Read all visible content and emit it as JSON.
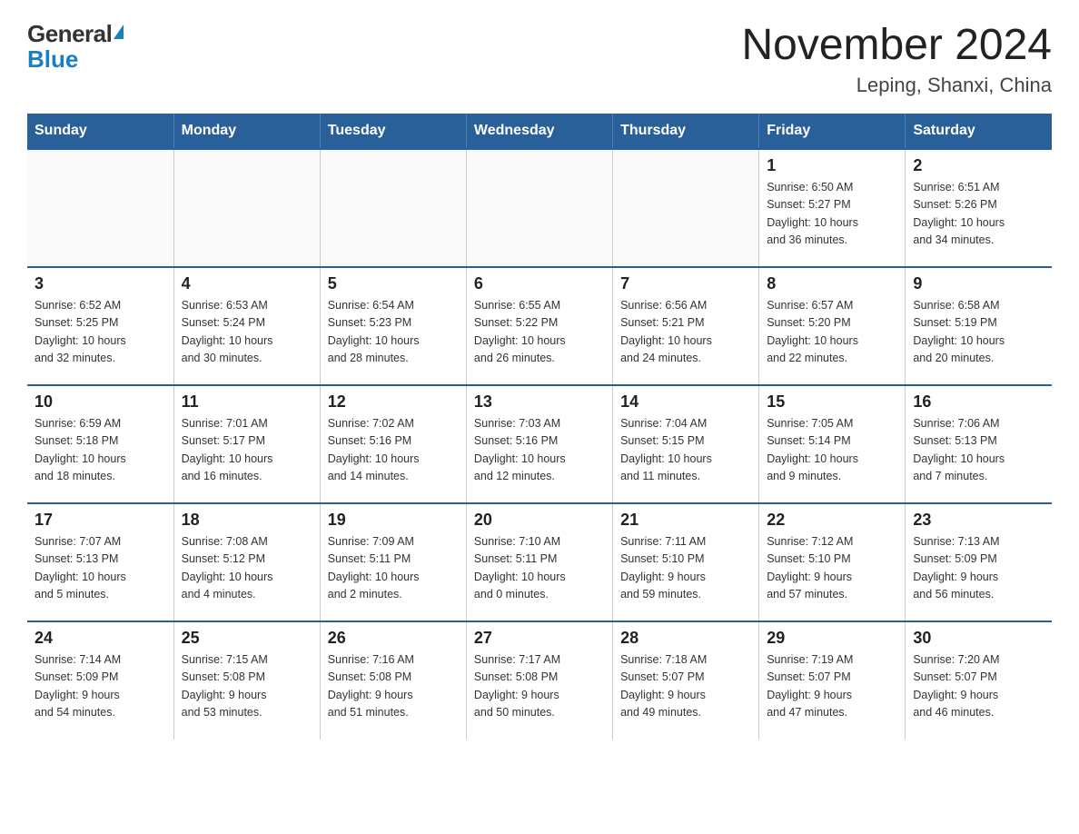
{
  "logo": {
    "general": "General",
    "blue": "Blue",
    "triangle": "▶"
  },
  "title": "November 2024",
  "subtitle": "Leping, Shanxi, China",
  "weekdays": [
    "Sunday",
    "Monday",
    "Tuesday",
    "Wednesday",
    "Thursday",
    "Friday",
    "Saturday"
  ],
  "weeks": [
    [
      {
        "day": "",
        "info": ""
      },
      {
        "day": "",
        "info": ""
      },
      {
        "day": "",
        "info": ""
      },
      {
        "day": "",
        "info": ""
      },
      {
        "day": "",
        "info": ""
      },
      {
        "day": "1",
        "info": "Sunrise: 6:50 AM\nSunset: 5:27 PM\nDaylight: 10 hours\nand 36 minutes."
      },
      {
        "day": "2",
        "info": "Sunrise: 6:51 AM\nSunset: 5:26 PM\nDaylight: 10 hours\nand 34 minutes."
      }
    ],
    [
      {
        "day": "3",
        "info": "Sunrise: 6:52 AM\nSunset: 5:25 PM\nDaylight: 10 hours\nand 32 minutes."
      },
      {
        "day": "4",
        "info": "Sunrise: 6:53 AM\nSunset: 5:24 PM\nDaylight: 10 hours\nand 30 minutes."
      },
      {
        "day": "5",
        "info": "Sunrise: 6:54 AM\nSunset: 5:23 PM\nDaylight: 10 hours\nand 28 minutes."
      },
      {
        "day": "6",
        "info": "Sunrise: 6:55 AM\nSunset: 5:22 PM\nDaylight: 10 hours\nand 26 minutes."
      },
      {
        "day": "7",
        "info": "Sunrise: 6:56 AM\nSunset: 5:21 PM\nDaylight: 10 hours\nand 24 minutes."
      },
      {
        "day": "8",
        "info": "Sunrise: 6:57 AM\nSunset: 5:20 PM\nDaylight: 10 hours\nand 22 minutes."
      },
      {
        "day": "9",
        "info": "Sunrise: 6:58 AM\nSunset: 5:19 PM\nDaylight: 10 hours\nand 20 minutes."
      }
    ],
    [
      {
        "day": "10",
        "info": "Sunrise: 6:59 AM\nSunset: 5:18 PM\nDaylight: 10 hours\nand 18 minutes."
      },
      {
        "day": "11",
        "info": "Sunrise: 7:01 AM\nSunset: 5:17 PM\nDaylight: 10 hours\nand 16 minutes."
      },
      {
        "day": "12",
        "info": "Sunrise: 7:02 AM\nSunset: 5:16 PM\nDaylight: 10 hours\nand 14 minutes."
      },
      {
        "day": "13",
        "info": "Sunrise: 7:03 AM\nSunset: 5:16 PM\nDaylight: 10 hours\nand 12 minutes."
      },
      {
        "day": "14",
        "info": "Sunrise: 7:04 AM\nSunset: 5:15 PM\nDaylight: 10 hours\nand 11 minutes."
      },
      {
        "day": "15",
        "info": "Sunrise: 7:05 AM\nSunset: 5:14 PM\nDaylight: 10 hours\nand 9 minutes."
      },
      {
        "day": "16",
        "info": "Sunrise: 7:06 AM\nSunset: 5:13 PM\nDaylight: 10 hours\nand 7 minutes."
      }
    ],
    [
      {
        "day": "17",
        "info": "Sunrise: 7:07 AM\nSunset: 5:13 PM\nDaylight: 10 hours\nand 5 minutes."
      },
      {
        "day": "18",
        "info": "Sunrise: 7:08 AM\nSunset: 5:12 PM\nDaylight: 10 hours\nand 4 minutes."
      },
      {
        "day": "19",
        "info": "Sunrise: 7:09 AM\nSunset: 5:11 PM\nDaylight: 10 hours\nand 2 minutes."
      },
      {
        "day": "20",
        "info": "Sunrise: 7:10 AM\nSunset: 5:11 PM\nDaylight: 10 hours\nand 0 minutes."
      },
      {
        "day": "21",
        "info": "Sunrise: 7:11 AM\nSunset: 5:10 PM\nDaylight: 9 hours\nand 59 minutes."
      },
      {
        "day": "22",
        "info": "Sunrise: 7:12 AM\nSunset: 5:10 PM\nDaylight: 9 hours\nand 57 minutes."
      },
      {
        "day": "23",
        "info": "Sunrise: 7:13 AM\nSunset: 5:09 PM\nDaylight: 9 hours\nand 56 minutes."
      }
    ],
    [
      {
        "day": "24",
        "info": "Sunrise: 7:14 AM\nSunset: 5:09 PM\nDaylight: 9 hours\nand 54 minutes."
      },
      {
        "day": "25",
        "info": "Sunrise: 7:15 AM\nSunset: 5:08 PM\nDaylight: 9 hours\nand 53 minutes."
      },
      {
        "day": "26",
        "info": "Sunrise: 7:16 AM\nSunset: 5:08 PM\nDaylight: 9 hours\nand 51 minutes."
      },
      {
        "day": "27",
        "info": "Sunrise: 7:17 AM\nSunset: 5:08 PM\nDaylight: 9 hours\nand 50 minutes."
      },
      {
        "day": "28",
        "info": "Sunrise: 7:18 AM\nSunset: 5:07 PM\nDaylight: 9 hours\nand 49 minutes."
      },
      {
        "day": "29",
        "info": "Sunrise: 7:19 AM\nSunset: 5:07 PM\nDaylight: 9 hours\nand 47 minutes."
      },
      {
        "day": "30",
        "info": "Sunrise: 7:20 AM\nSunset: 5:07 PM\nDaylight: 9 hours\nand 46 minutes."
      }
    ]
  ]
}
